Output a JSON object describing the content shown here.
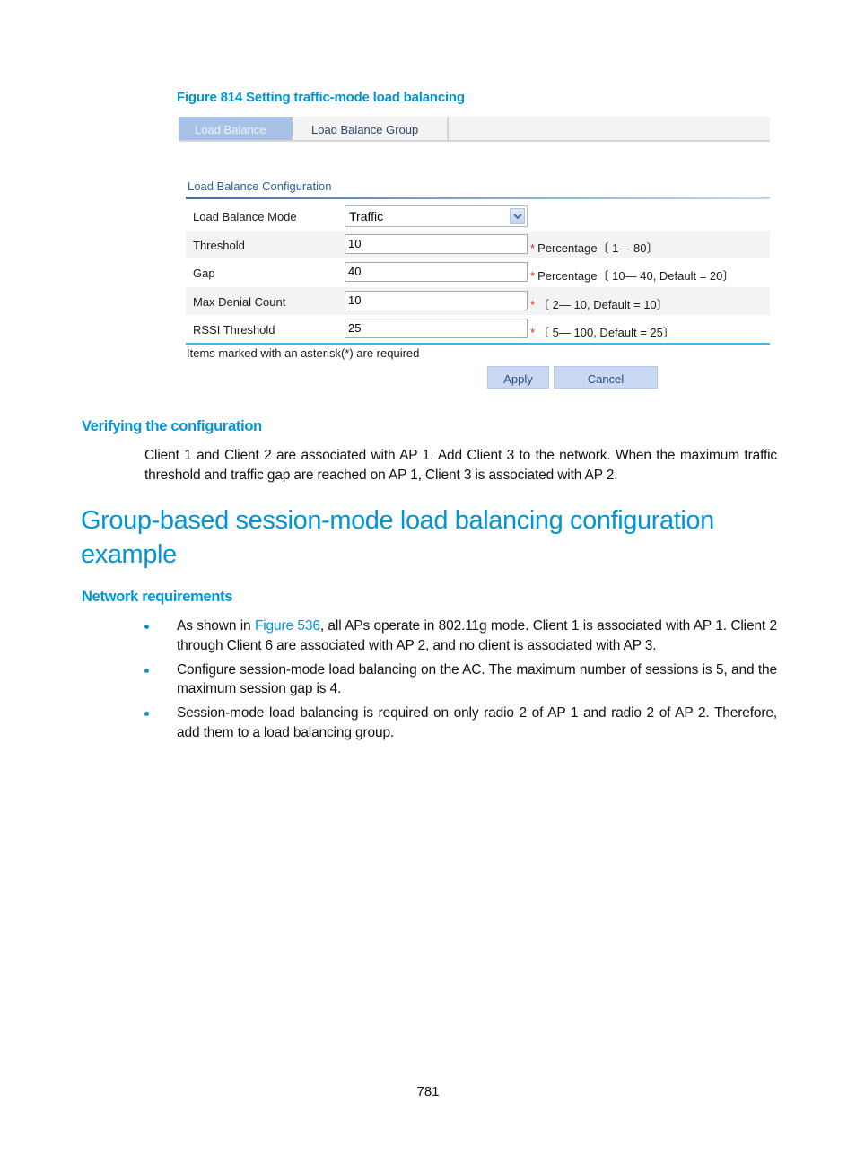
{
  "figure": {
    "caption": "Figure 814 Setting traffic-mode load balancing",
    "tabs": [
      {
        "label": "Load Balance",
        "active": true
      },
      {
        "label": "Load Balance Group",
        "active": false
      }
    ],
    "section_title": "Load Balance Configuration",
    "fields": [
      {
        "label": "Load Balance Mode",
        "type": "select",
        "value": "Traffic",
        "hint": ""
      },
      {
        "label": "Threshold",
        "type": "text",
        "value": "10",
        "required": "*",
        "hint": "Percentage〔 1— 80〕"
      },
      {
        "label": "Gap",
        "type": "text",
        "value": "40",
        "required": "*",
        "hint": "Percentage〔 10— 40, Default = 20〕"
      },
      {
        "label": "Max Denial Count",
        "type": "text",
        "value": "10",
        "required": "*",
        "hint": "〔 2— 10, Default = 10〕"
      },
      {
        "label": "RSSI Threshold",
        "type": "text",
        "value": "25",
        "required": "*",
        "hint": "〔 5— 100, Default = 25〕"
      }
    ],
    "required_note": "Items marked with an asterisk(*) are required",
    "buttons": {
      "apply": "Apply",
      "cancel": "Cancel"
    }
  },
  "verify": {
    "heading": "Verifying the configuration",
    "text": "Client 1 and Client 2 are associated with AP 1. Add Client 3 to the network. When the maximum traffic threshold and traffic gap are reached on AP 1, Client 3 is associated with AP 2."
  },
  "example": {
    "heading": "Group-based session-mode load balancing configuration example",
    "subheading": "Network requirements",
    "bullets": [
      {
        "before": "As shown in ",
        "link": "Figure 536",
        "after": ", all APs operate in 802.11g mode. Client 1 is associated with AP 1. Client 2 through Client 6 are associated with AP 2, and no client is associated with AP 3."
      },
      {
        "before": "Configure session-mode load balancing on the AC. The maximum number of sessions is 5, and the maximum session gap is 4.",
        "link": "",
        "after": ""
      },
      {
        "before": "Session-mode load balancing is required on only radio 2 of AP 1 and radio 2 of AP 2. Therefore, add them to a load balancing group.",
        "link": "",
        "after": ""
      }
    ]
  },
  "page_number": "781",
  "colors": {
    "heading_blue": "#0096d6",
    "active_tab": "#a7c1e7",
    "button_bg": "#c9d9f3",
    "required_star": "#e02020"
  }
}
